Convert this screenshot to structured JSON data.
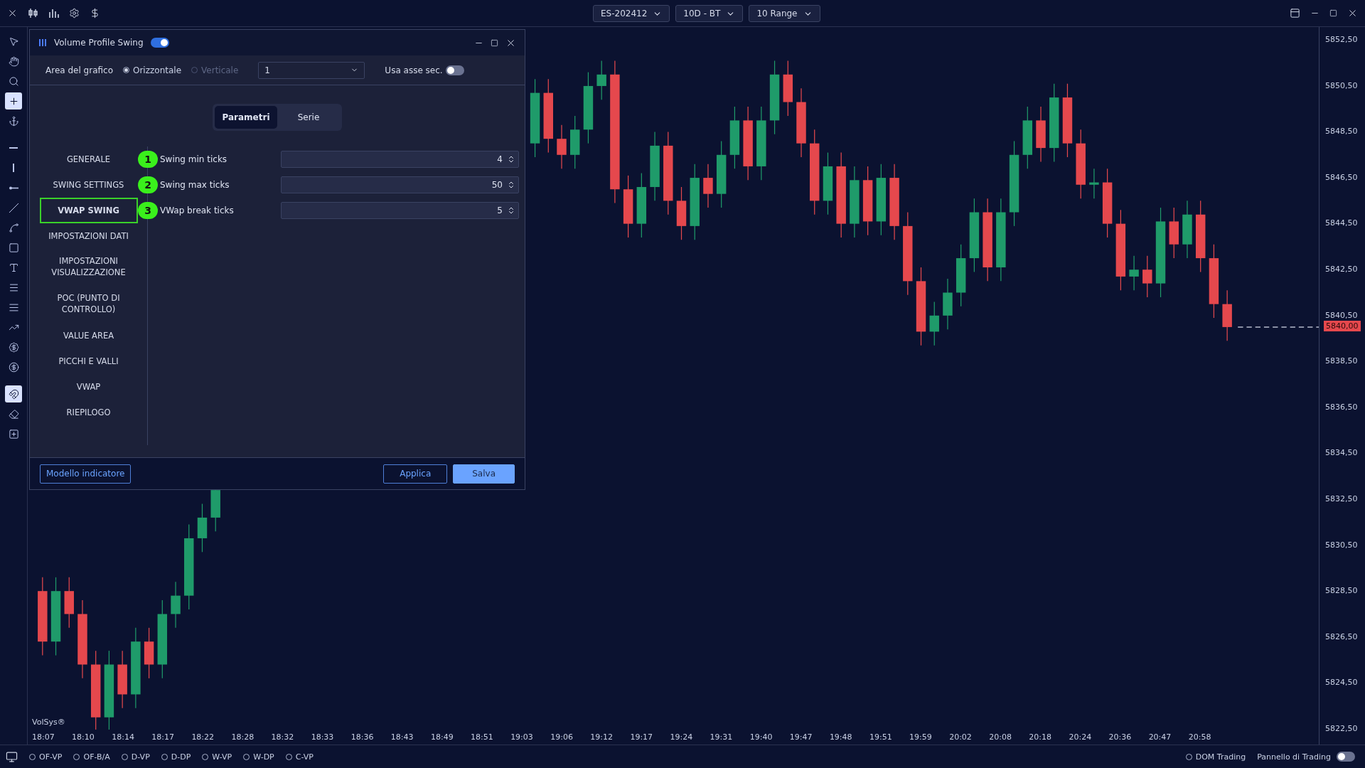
{
  "top_bar": {
    "dropdowns": [
      {
        "label": "ES-202412"
      },
      {
        "label": "10D - BT"
      },
      {
        "label": "10 Range"
      }
    ]
  },
  "tool_groups": [
    {
      "tools": [
        {
          "active": false
        },
        {
          "active": false
        },
        {
          "active": false
        },
        {
          "active": true
        },
        {
          "active": false
        }
      ]
    },
    {
      "tools": [
        {
          "active": false
        },
        {
          "active": false
        },
        {
          "active": false
        },
        {
          "active": false
        },
        {
          "active": false
        },
        {
          "active": false
        },
        {
          "active": false
        },
        {
          "active": false
        },
        {
          "active": false
        },
        {
          "active": false
        },
        {
          "active": false
        },
        {
          "active": false
        }
      ]
    },
    {
      "tools": [
        {
          "active": true
        },
        {
          "active": false
        },
        {
          "active": false
        }
      ]
    }
  ],
  "dialog": {
    "title": "Volume Profile Swing",
    "enabled": true,
    "area_label": "Area del grafico",
    "orientation": [
      {
        "label": "Orizzontale",
        "selected": true,
        "disabled": false
      },
      {
        "label": "Verticale",
        "selected": false,
        "disabled": true
      }
    ],
    "pane_select": {
      "value": "1"
    },
    "secondary_axis": {
      "label": "Usa asse sec.",
      "on": false
    },
    "tabs": [
      {
        "label": "Parametri",
        "selected": true
      },
      {
        "label": "Serie",
        "selected": false
      }
    ],
    "nav": [
      {
        "label": "GENERALE",
        "selected": false
      },
      {
        "label": "SWING SETTINGS",
        "selected": false
      },
      {
        "label": "VWAP SWING",
        "selected": true
      },
      {
        "label": "IMPOSTAZIONI DATI",
        "selected": false
      },
      {
        "label": "IMPOSTAZIONI VISUALIZZAZIONE",
        "selected": false
      },
      {
        "label": "POC (PUNTO DI CONTROLLO)",
        "selected": false
      },
      {
        "label": "VALUE AREA",
        "selected": false
      },
      {
        "label": "PICCHI E VALLI",
        "selected": false
      },
      {
        "label": "VWAP",
        "selected": false
      },
      {
        "label": "RIEPILOGO",
        "selected": false
      }
    ],
    "params": [
      {
        "badge": "1",
        "label": "Swing min ticks",
        "value": "4"
      },
      {
        "badge": "2",
        "label": "Swing max ticks",
        "value": "50"
      },
      {
        "badge": "3",
        "label": "VWap break ticks",
        "value": "5"
      }
    ],
    "footer": {
      "template_button": "Modello indicatore",
      "apply_button": "Applica",
      "save_button": "Salva"
    }
  },
  "chart": {
    "watermark": "VolSys®",
    "current_price": "5840,00",
    "price_labels": [
      "5852,50",
      "5850,50",
      "5848,50",
      "5846,50",
      "5844,50",
      "5842,50",
      "5840,50",
      "5838,50",
      "5836,50",
      "5834,50",
      "5832,50",
      "5830,50",
      "5828,50",
      "5826,50",
      "5824,50",
      "5822,50"
    ],
    "time_labels": [
      "18:07",
      "18:10",
      "18:14",
      "18:17",
      "18:22",
      "18:28",
      "18:32",
      "18:33",
      "18:36",
      "18:43",
      "18:49",
      "18:51",
      "19:03",
      "19:06",
      "19:12",
      "19:17",
      "19:24",
      "19:31",
      "19:40",
      "19:47",
      "19:48",
      "19:51",
      "19:59",
      "20:02",
      "20:08",
      "20:18",
      "20:24",
      "20:36",
      "20:47",
      "20:58"
    ]
  },
  "bottom_bar": {
    "indicators": [
      {
        "label": "OF-VP",
        "selected": false
      },
      {
        "label": "OF-B/A",
        "selected": false
      },
      {
        "label": "D-VP",
        "selected": false
      },
      {
        "label": "D-DP",
        "selected": false
      },
      {
        "label": "W-VP",
        "selected": false
      },
      {
        "label": "W-DP",
        "selected": false
      },
      {
        "label": "C-VP",
        "selected": false
      }
    ],
    "dom_trading": {
      "label": "DOM Trading",
      "selected": false
    },
    "trading_panel": {
      "label": "Pannello di Trading",
      "on": false
    }
  }
}
